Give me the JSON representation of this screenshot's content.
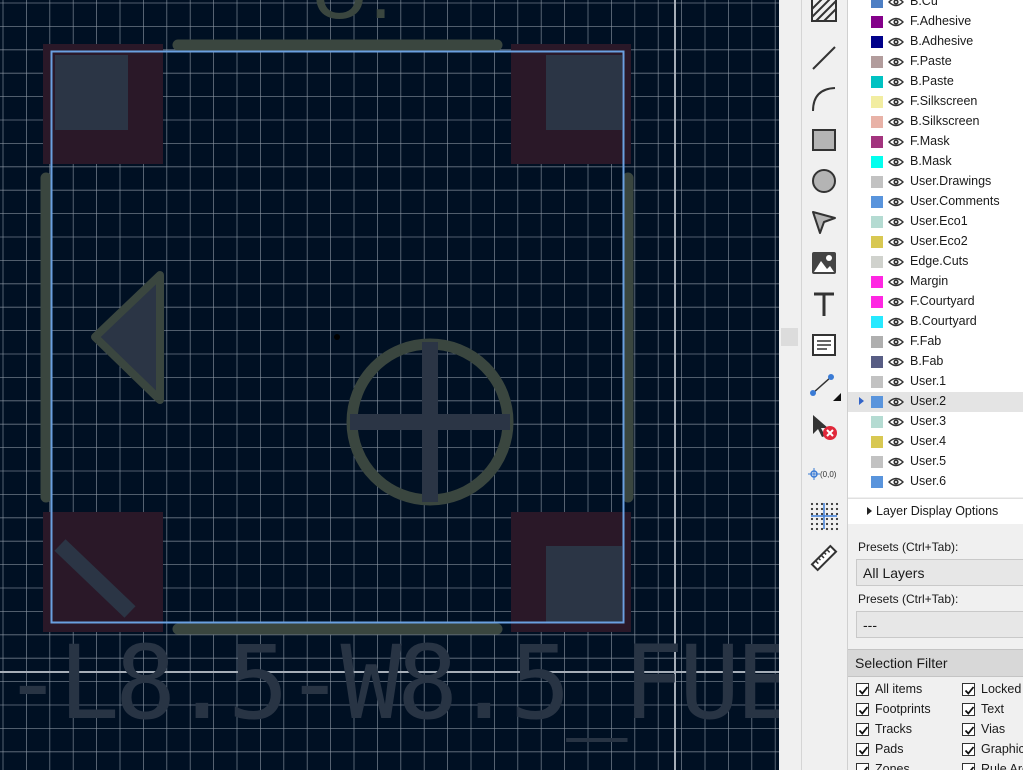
{
  "board_text": {
    "footprint_value": "-L8.5-W8.5_FUE",
    "reference_partial": "U."
  },
  "colors": {
    "canvas_bg": "#001023",
    "grid": "#8f9aa6",
    "silkscreen": "#3a463f",
    "pad": "#2a1828",
    "fab": "#2b3545",
    "selection": "#6aa0e0",
    "value_text": "#283444"
  },
  "toolbar": {
    "tools": [
      {
        "name": "hatch-tool-icon"
      },
      {
        "name": "draw-line-icon"
      },
      {
        "name": "draw-arc-icon"
      },
      {
        "name": "draw-rectangle-icon"
      },
      {
        "name": "draw-circle-icon"
      },
      {
        "name": "draw-polygon-icon"
      },
      {
        "name": "add-image-icon"
      },
      {
        "name": "add-text-icon"
      },
      {
        "name": "add-textbox-icon"
      },
      {
        "name": "add-dimension-icon"
      },
      {
        "name": "delete-tool-icon"
      },
      {
        "name": "set-origin-icon",
        "label": "(0,0)"
      },
      {
        "name": "grid-origin-icon"
      },
      {
        "name": "measure-tool-icon"
      }
    ]
  },
  "layers": [
    {
      "name": "B.Cu",
      "color": "#4d7fc4"
    },
    {
      "name": "F.Adhesive",
      "color": "#84008a"
    },
    {
      "name": "B.Adhesive",
      "color": "#00008a"
    },
    {
      "name": "F.Paste",
      "color": "#b29c9c"
    },
    {
      "name": "B.Paste",
      "color": "#00c2c2"
    },
    {
      "name": "F.Silkscreen",
      "color": "#f2eda1"
    },
    {
      "name": "B.Silkscreen",
      "color": "#e8b2a7"
    },
    {
      "name": "F.Mask",
      "color": "#a3347e"
    },
    {
      "name": "B.Mask",
      "color": "#02ffee"
    },
    {
      "name": "User.Drawings",
      "color": "#c2c2c2"
    },
    {
      "name": "User.Comments",
      "color": "#5994dc"
    },
    {
      "name": "User.Eco1",
      "color": "#b4dbd2"
    },
    {
      "name": "User.Eco2",
      "color": "#d8c852"
    },
    {
      "name": "Edge.Cuts",
      "color": "#d0d2cd"
    },
    {
      "name": "Margin",
      "color": "#ff26e2"
    },
    {
      "name": "F.Courtyard",
      "color": "#ff26e2"
    },
    {
      "name": "B.Courtyard",
      "color": "#26e9ff"
    },
    {
      "name": "F.Fab",
      "color": "#afafaf"
    },
    {
      "name": "B.Fab",
      "color": "#585d84"
    },
    {
      "name": "User.1",
      "color": "#c2c2c2"
    },
    {
      "name": "User.2",
      "color": "#5994dc",
      "selected": true
    },
    {
      "name": "User.3",
      "color": "#b4dbd2"
    },
    {
      "name": "User.4",
      "color": "#d8c852"
    },
    {
      "name": "User.5",
      "color": "#c2c2c2"
    },
    {
      "name": "User.6",
      "color": "#5994dc"
    }
  ],
  "panel": {
    "layer_display_options": "Layer Display Options",
    "presets_label_1": "Presets (Ctrl+Tab):",
    "presets_value_1": "All Layers",
    "presets_label_2": "Presets (Ctrl+Tab):",
    "presets_value_2": "---",
    "selection_filter_title": "Selection Filter"
  },
  "selection_filter": {
    "left": [
      {
        "label": "All items",
        "checked": true
      },
      {
        "label": "Footprints",
        "checked": true
      },
      {
        "label": "Tracks",
        "checked": true
      },
      {
        "label": "Pads",
        "checked": true
      },
      {
        "label": "Zones",
        "checked": true
      }
    ],
    "right": [
      {
        "label": "Locked",
        "checked": true
      },
      {
        "label": "Text",
        "checked": true
      },
      {
        "label": "Vias",
        "checked": true
      },
      {
        "label": "Graphics",
        "checked": true
      },
      {
        "label": "Rule Areas",
        "checked": true
      }
    ]
  }
}
